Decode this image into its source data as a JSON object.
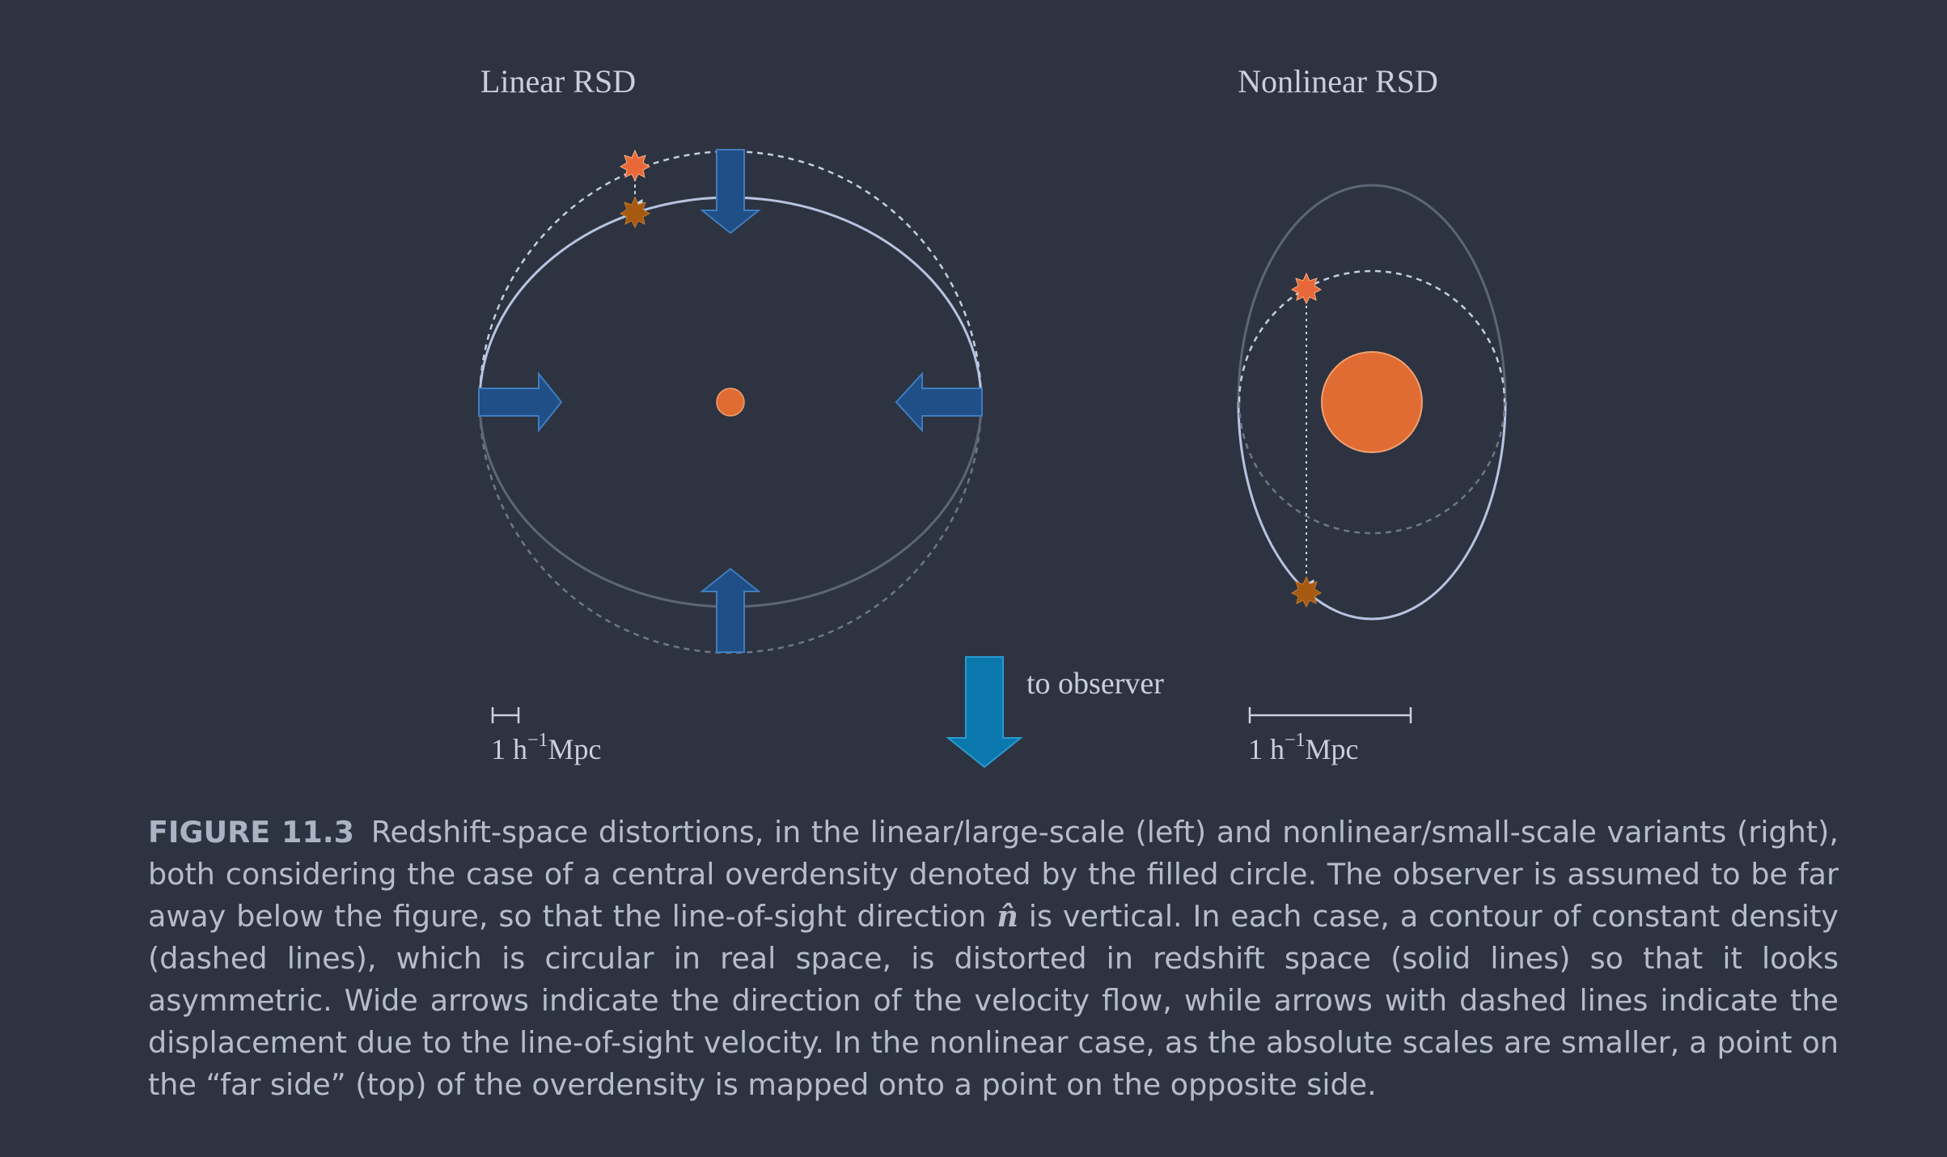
{
  "panels": {
    "linear": {
      "title": "Linear RSD",
      "scale_label": "1 h",
      "scale_exponent": "−1",
      "scale_unit": "Mpc"
    },
    "nonlinear": {
      "title": "Nonlinear RSD",
      "scale_label": "1 h",
      "scale_exponent": "−1",
      "scale_unit": "Mpc"
    }
  },
  "observer_label": "to observer",
  "caption": {
    "figure_number": "FIGURE 11.3",
    "part1": "Redshift-space distortions, in the linear/large-scale (left) and nonlinear/small-scale variants (right), both considering the case of a central overdensity denoted by the filled circle. The observer is assumed to be far away below the figure, so that the line-of-sight direction ",
    "symbol": "n̂",
    "part2": " is vertical. In each case, a contour of constant density (dashed lines), which is circular in real space, is distorted in redshift space (solid lines) so that it looks asymmetric. Wide arrows indicate the direction of the velocity flow, while arrows with dashed lines indicate the displacement due to the line-of-sight velocity. In the nonlinear case, as the absolute scales are smaller, a point on the “far side” (top) of the overdensity is mapped onto a point on the opposite side."
  },
  "colors": {
    "background": "#2d3340",
    "overdensity": "#e06c33",
    "flow_arrow": "#1f4f86",
    "observer_arrow": "#0b78ad",
    "contour": "#aab7d2",
    "star_real": "#e8683a",
    "star_redshift": "#a65a10"
  },
  "icons": {
    "flow_arrow": "wide-arrow-icon",
    "observer_arrow": "down-arrow-icon",
    "galaxy_marker": "star-burst-icon"
  }
}
